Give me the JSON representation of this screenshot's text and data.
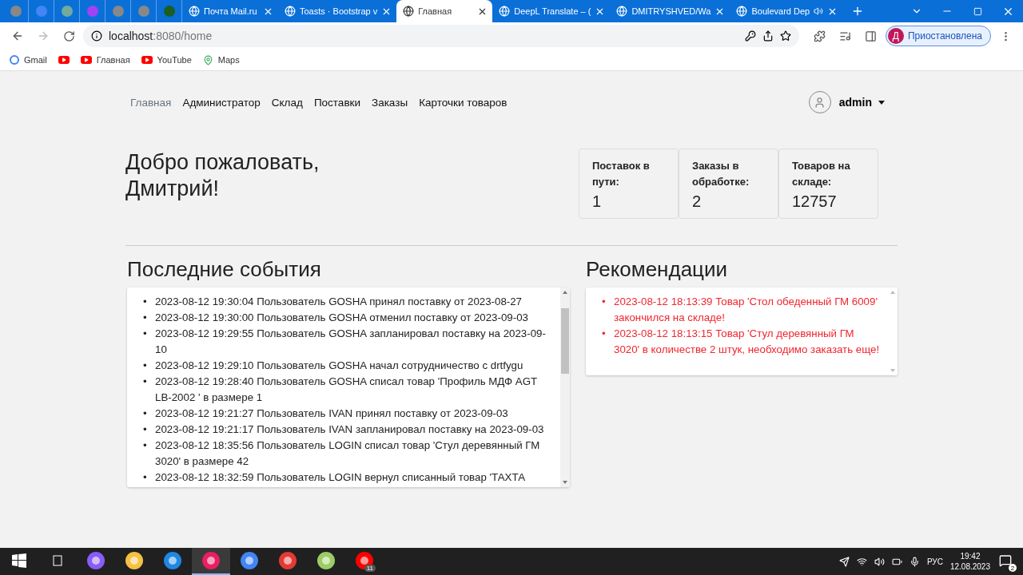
{
  "browser": {
    "tabs": [
      {
        "kind": "pinned",
        "selected": false
      },
      {
        "kind": "pinned",
        "selected": false
      },
      {
        "kind": "pinned",
        "selected": false
      },
      {
        "kind": "pinned",
        "selected": false
      },
      {
        "kind": "pinned",
        "selected": false
      },
      {
        "kind": "pinned",
        "selected": false
      },
      {
        "kind": "pinned",
        "selected": false
      },
      {
        "kind": "page",
        "title": "Почта Mail.ru",
        "selected": false,
        "audio": false
      },
      {
        "kind": "page",
        "title": "Toasts · Bootstrap v",
        "selected": false,
        "audio": false
      },
      {
        "kind": "page",
        "title": "Главная",
        "selected": true,
        "audio": false
      },
      {
        "kind": "page",
        "title": "DeepL Translate – (",
        "selected": false,
        "audio": false
      },
      {
        "kind": "page",
        "title": "DMITRYSHVED/Wa",
        "selected": false,
        "audio": false
      },
      {
        "kind": "page",
        "title": "Boulevard Dep",
        "selected": false,
        "audio": true
      }
    ],
    "address": {
      "host": "localhost",
      "path": ":8080/home"
    },
    "profile": {
      "initial": "Д",
      "status": "Приостановлена"
    },
    "bookmarks": [
      {
        "kind": "link",
        "label": "Gmail"
      },
      {
        "kind": "icon"
      },
      {
        "kind": "link",
        "label": "Главная"
      },
      {
        "kind": "link",
        "label": "YouTube"
      },
      {
        "kind": "link",
        "label": "Maps"
      }
    ]
  },
  "page": {
    "nav": [
      {
        "label": "Главная",
        "selected": true
      },
      {
        "label": "Администратор",
        "selected": false
      },
      {
        "label": "Склад",
        "selected": false
      },
      {
        "label": "Поставки",
        "selected": false
      },
      {
        "label": "Заказы",
        "selected": false
      },
      {
        "label": "Карточки товаров",
        "selected": false
      }
    ],
    "user": "admin",
    "welcome": "Добро пожаловать, Дмитрий!",
    "stats": [
      {
        "label": "Поставок в пути:",
        "value": "1"
      },
      {
        "label": "Заказы в обработке:",
        "value": "2"
      },
      {
        "label": "Товаров на складе:",
        "value": "12757"
      }
    ],
    "events_title": "Последние события",
    "marker": "•",
    "events": [
      "2023-08-12 19:30:04 Пользователь GOSHA принял поставку от 2023-08-27",
      "2023-08-12 19:30:00 Пользователь GOSHA отменил поставку от 2023-09-03",
      "2023-08-12 19:29:55 Пользователь GOSHA запланировал поставку на 2023-09-10",
      "2023-08-12 19:29:10 Пользователь GOSHA начал сотрудничество с drtfygu",
      "2023-08-12 19:28:40 Пользователь GOSHA списал товар 'Профиль МДФ AGT LB-2002 ' в размере 1",
      "2023-08-12 19:21:27 Пользователь IVAN принял поставку от 2023-09-03",
      "2023-08-12 19:21:17 Пользователь IVAN запланировал поставку на 2023-09-03",
      "2023-08-12 18:35:56 Пользователь LOGIN списал товар 'Стул деревянный ГМ 3020' в размере 42",
      "2023-08-12 18:32:59 Пользователь LOGIN вернул списанный товар 'ТАХТА"
    ],
    "recommendations_title": "Рекомендации",
    "recommendations": [
      "2023-08-12 18:13:39 Товар 'Стол обеденный ГМ 6009' закончился на складе!",
      "2023-08-12 18:13:15 Товар 'Стул деревянный ГМ 3020' в количестве 2 штук, необходимо заказать еще!"
    ]
  },
  "taskbar": {
    "apps": [
      {
        "active": false
      },
      {
        "active": false
      },
      {
        "active": false
      },
      {
        "active": false
      },
      {
        "active": false
      },
      {
        "active": true
      },
      {
        "active": false
      },
      {
        "active": false
      },
      {
        "active": false
      },
      {
        "active": false,
        "badge": "11"
      }
    ],
    "language": "РУС",
    "time": "19:42",
    "date": "12.08.2023",
    "notifications": "2"
  }
}
